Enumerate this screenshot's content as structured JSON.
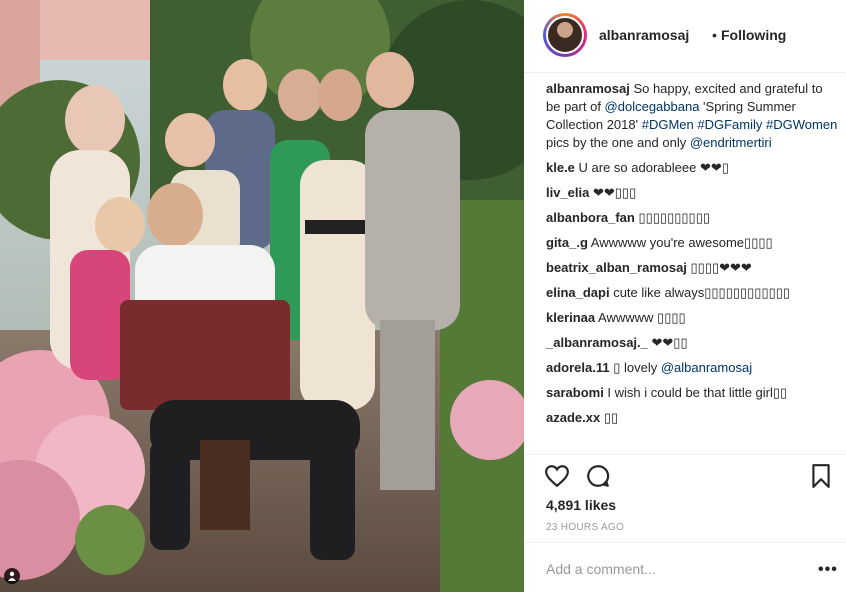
{
  "header": {
    "username": "albanramosaj",
    "separator": "•",
    "follow_status": "Following"
  },
  "caption": {
    "username": "albanramosaj",
    "text_1": " So happy, excited and grateful to be part of ",
    "mention_1": "@dolcegabbana",
    "text_2": " 'Spring Summer Collection 2018' ",
    "hashtag_1": "#DGMen",
    "text_3": " ",
    "hashtag_2": "#DGFamily",
    "text_4": " ",
    "hashtag_3": "#DGWomen",
    "text_5": " pics by the one and only ",
    "mention_2": "@endritmertiri"
  },
  "comments": [
    {
      "user": "kle.e",
      "text": " U are so adorableee ❤❤▯"
    },
    {
      "user": "liv_elia",
      "text": " ❤❤▯▯▯"
    },
    {
      "user": "albanbora_fan",
      "text": " ▯▯▯▯▯▯▯▯▯▯"
    },
    {
      "user": "gita_.g",
      "text": " Awwwww you're awesome▯▯▯▯"
    },
    {
      "user": "beatrix_alban_ramosaj",
      "text": " ▯▯▯▯❤❤❤"
    },
    {
      "user": "elina_dapi",
      "text": " cute like always▯▯▯▯▯▯▯▯▯▯▯▯"
    },
    {
      "user": "klerinaa",
      "text": " Awwwww ▯▯▯▯"
    },
    {
      "user": "_albanramosaj._",
      "text": " ❤❤▯▯"
    },
    {
      "user": "adorela.11",
      "text": " ▯ lovely ",
      "mention": "@albanramosaj"
    },
    {
      "user": "sarabomi",
      "text": " I wish i could be that little girl▯▯"
    },
    {
      "user": "azade.xx",
      "text": " ▯▯"
    }
  ],
  "actions": {
    "like_icon": "heart-icon",
    "comment_icon": "comment-icon",
    "save_icon": "bookmark-icon"
  },
  "likes": "4,891 likes",
  "time_ago": "23 HOURS AGO",
  "add_comment": {
    "placeholder": "Add a comment...",
    "more_icon": "•••"
  },
  "colors": {
    "link": "#003569",
    "muted": "#999999",
    "border": "#efefef"
  }
}
